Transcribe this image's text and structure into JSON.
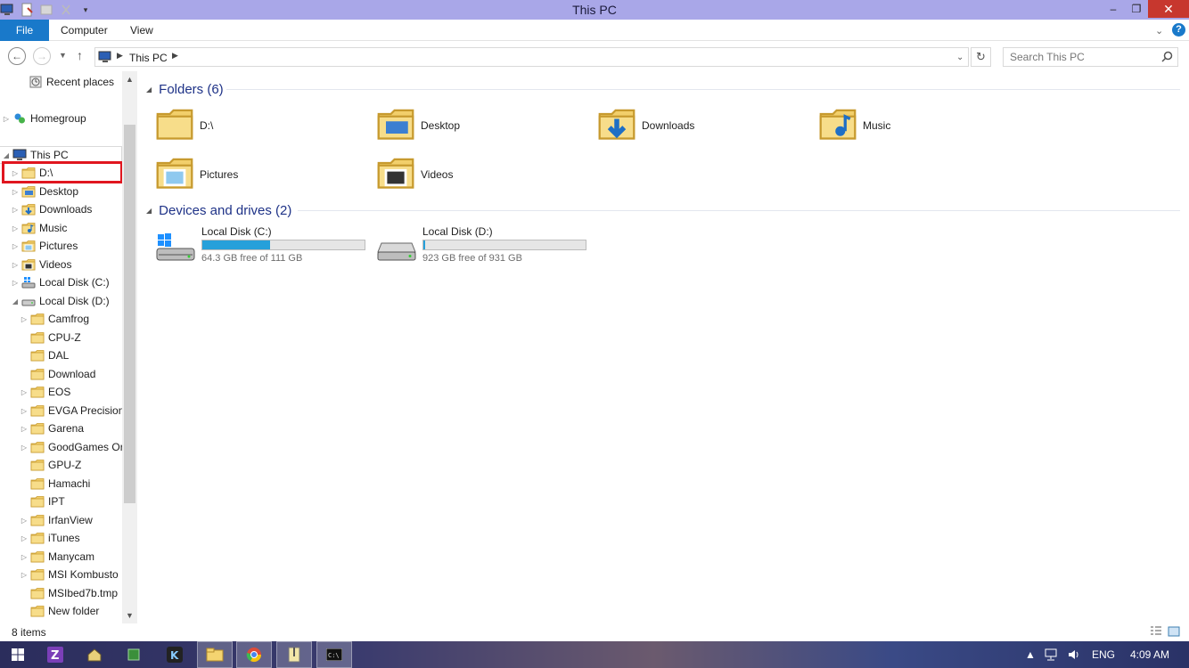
{
  "window": {
    "title": "This PC",
    "controls": {
      "minimize": "–",
      "maximize": "❐",
      "close": "✕"
    }
  },
  "ribbon": {
    "tabs": [
      "File",
      "Computer",
      "View"
    ]
  },
  "address": {
    "crumb": "This PC",
    "search_placeholder": "Search This PC"
  },
  "nav_pane": {
    "items": [
      {
        "label": "Recent places",
        "icon": "recent-places-icon"
      },
      {
        "label": "Homegroup",
        "icon": "homegroup-icon"
      },
      {
        "label": "This PC",
        "icon": "computer-icon"
      },
      {
        "label": "D:\\",
        "icon": "folder-icon"
      },
      {
        "label": "Desktop",
        "icon": "desktop-folder-icon"
      },
      {
        "label": "Downloads",
        "icon": "downloads-folder-icon"
      },
      {
        "label": "Music",
        "icon": "music-folder-icon"
      },
      {
        "label": "Pictures",
        "icon": "pictures-folder-icon"
      },
      {
        "label": "Videos",
        "icon": "videos-folder-icon"
      },
      {
        "label": "Local Disk (C:)",
        "icon": "system-drive-icon"
      },
      {
        "label": "Local Disk (D:)",
        "icon": "drive-icon"
      },
      {
        "label": "Camfrog",
        "icon": "folder-icon"
      },
      {
        "label": "CPU-Z",
        "icon": "folder-icon"
      },
      {
        "label": "DAL",
        "icon": "folder-icon"
      },
      {
        "label": "Download",
        "icon": "folder-icon"
      },
      {
        "label": "EOS",
        "icon": "folder-icon"
      },
      {
        "label": "EVGA Precision",
        "icon": "folder-icon"
      },
      {
        "label": "Garena",
        "icon": "folder-icon"
      },
      {
        "label": "GoodGames Or",
        "icon": "folder-icon"
      },
      {
        "label": "GPU-Z",
        "icon": "folder-icon"
      },
      {
        "label": "Hamachi",
        "icon": "folder-icon"
      },
      {
        "label": "IPT",
        "icon": "folder-icon"
      },
      {
        "label": "IrfanView",
        "icon": "folder-icon"
      },
      {
        "label": "iTunes",
        "icon": "folder-icon"
      },
      {
        "label": "Manycam",
        "icon": "folder-icon"
      },
      {
        "label": "MSI Kombusto",
        "icon": "folder-icon"
      },
      {
        "label": "MSIbed7b.tmp",
        "icon": "folder-icon"
      },
      {
        "label": "New folder",
        "icon": "folder-icon"
      }
    ]
  },
  "content": {
    "folders_header": "Folders (6)",
    "folders": [
      {
        "label": "D:\\",
        "icon": "folder-icon"
      },
      {
        "label": "Desktop",
        "icon": "desktop-folder-icon"
      },
      {
        "label": "Downloads",
        "icon": "downloads-folder-icon"
      },
      {
        "label": "Music",
        "icon": "music-folder-icon"
      },
      {
        "label": "Pictures",
        "icon": "pictures-folder-icon"
      },
      {
        "label": "Videos",
        "icon": "videos-folder-icon"
      }
    ],
    "drives_header": "Devices and drives (2)",
    "drives": [
      {
        "name": "Local Disk (C:)",
        "free": "64.3 GB free of 111 GB",
        "used_fraction": 0.42
      },
      {
        "name": "Local Disk (D:)",
        "free": "923 GB free of 931 GB",
        "used_fraction": 0.01
      }
    ]
  },
  "status": {
    "count": "8 items"
  },
  "taskbar": {
    "lang": "ENG",
    "time": "4:09 AM"
  },
  "colors": {
    "titlebar": "#a9a7e8",
    "accent": "#1979ca",
    "close": "#c7372e",
    "highlight": "#e0161f",
    "drive_fill": "#26a0da",
    "group_header": "#1e3287"
  }
}
